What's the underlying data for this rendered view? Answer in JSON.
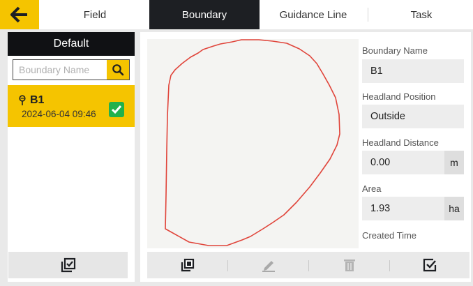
{
  "tabs": [
    {
      "label": "Field",
      "active": false
    },
    {
      "label": "Boundary",
      "active": true
    },
    {
      "label": "Guidance Line",
      "active": false
    },
    {
      "label": "Task",
      "active": false
    }
  ],
  "sidebar": {
    "title": "Default",
    "search_placeholder": "Boundary Name",
    "items": [
      {
        "name": "B1",
        "time": "2024-06-04 09:46",
        "checked": true
      }
    ]
  },
  "properties": {
    "boundary_name_label": "Boundary Name",
    "boundary_name_value": "B1",
    "headland_position_label": "Headland Position",
    "headland_position_value": "Outside",
    "headland_distance_label": "Headland Distance",
    "headland_distance_value": "0.00",
    "headland_distance_unit": "m",
    "area_label": "Area",
    "area_value": "1.93",
    "area_unit": "ha",
    "created_time_label": "Created Time"
  },
  "colors": {
    "accent": "#f5c400",
    "dark": "#1d1f23",
    "check": "#22b14c",
    "boundary_line": "#e0443a"
  },
  "icons": [
    "back-arrow-icon",
    "search-icon",
    "pin-icon",
    "check-icon",
    "select-all-icon",
    "copy-icon",
    "edit-icon",
    "delete-icon",
    "confirm-icon"
  ]
}
